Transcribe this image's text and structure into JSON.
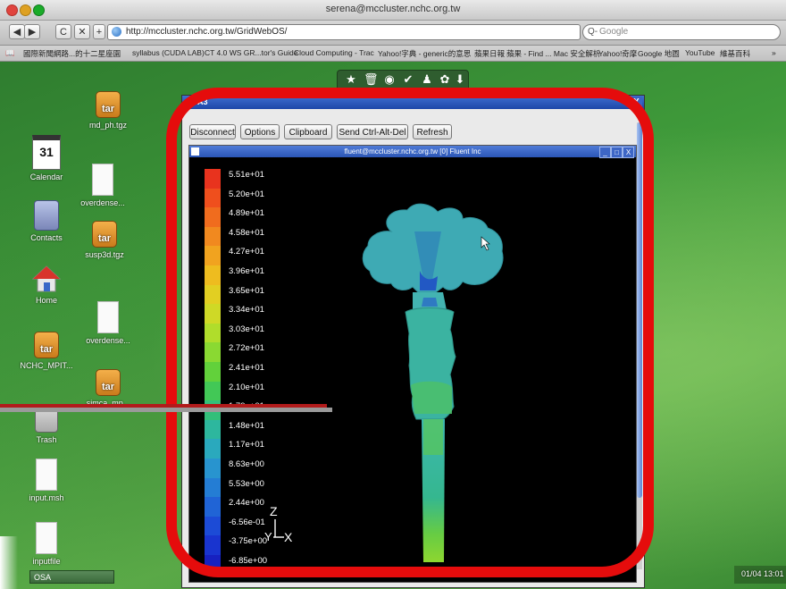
{
  "window": {
    "title": "serena@mccluster.nchc.org.tw"
  },
  "browser": {
    "url": "http://mccluster.nchc.org.tw/GridWebOS/",
    "search_placeholder": "Google",
    "bookmarks": [
      "國際新聞網路...的十二星座園",
      "syllabus (CUDA LAB)",
      "CT 4.0 WS GR...tor's Guide",
      "Cloud Computing - Trac",
      "Yahoo!字典 - generic的意思",
      "蘋果日報",
      "蘋果 - Find ... Mac 安全解析",
      "Yahoo!奇摩",
      "Google 地圖",
      "YouTube",
      "維基百科"
    ],
    "more_bookmarks": "»"
  },
  "desktop": {
    "icons": [
      {
        "label": "md_ph.tgz",
        "type": "tar",
        "badge": "tar"
      },
      {
        "label": "Calendar",
        "type": "calendar",
        "badge": "31"
      },
      {
        "label": "overdense...",
        "type": "doc"
      },
      {
        "label": "Contacts",
        "type": "contacts"
      },
      {
        "label": "susp3d.tgz",
        "type": "tar",
        "badge": "tar"
      },
      {
        "label": "Home",
        "type": "home"
      },
      {
        "label": "overdense...",
        "type": "doc"
      },
      {
        "label": "NCHC_MPIT...",
        "type": "tar",
        "badge": "tar"
      },
      {
        "label": "Trash",
        "type": "trash"
      },
      {
        "label": "simca_mp...",
        "type": "tar",
        "badge": "tar"
      },
      {
        "label": "input.msh",
        "type": "doc"
      },
      {
        "label": "inputfile",
        "type": "doc"
      }
    ],
    "taskbar_item": "OSA",
    "clock": "01/04  13:01"
  },
  "osa": {
    "title": "OSA3",
    "close": "X",
    "buttons": [
      "Disconnect",
      "Options",
      "Clipboard",
      "Send Ctrl-Alt-Del",
      "Refresh"
    ]
  },
  "fluent": {
    "title": "fluent@mccluster.nchc.org.tw [0] Fluent Inc",
    "controls": [
      "_",
      "□",
      "X"
    ],
    "colormap_labels": [
      "5.51e+01",
      "5.20e+01",
      "4.89e+01",
      "4.58e+01",
      "4.27e+01",
      "3.96e+01",
      "3.65e+01",
      "3.34e+01",
      "3.03e+01",
      "2.72e+01",
      "2.41e+01",
      "2.10e+01",
      "1.79e+01",
      "1.48e+01",
      "1.17e+01",
      "8.63e+00",
      "5.53e+00",
      "2.44e+00",
      "-6.56e-01",
      "-3.75e+00",
      "-6.85e+00"
    ],
    "axis_z": "Z",
    "axis_y": "Y",
    "axis_x": "X"
  },
  "colors": {
    "annotation_red": "#e50c0c",
    "colormap": [
      "#e8331e",
      "#ef4f1d",
      "#f06c1e",
      "#f1891f",
      "#f1a31f",
      "#eebc1f",
      "#e2cf22",
      "#cfd926",
      "#b0dd2b",
      "#8ad932",
      "#62d13b",
      "#42c856",
      "#33bf7a",
      "#2db79e",
      "#2aa9bd",
      "#2894cf",
      "#247dd4",
      "#2064d6",
      "#1c4bd6",
      "#1934cf",
      "#1721c0"
    ]
  }
}
